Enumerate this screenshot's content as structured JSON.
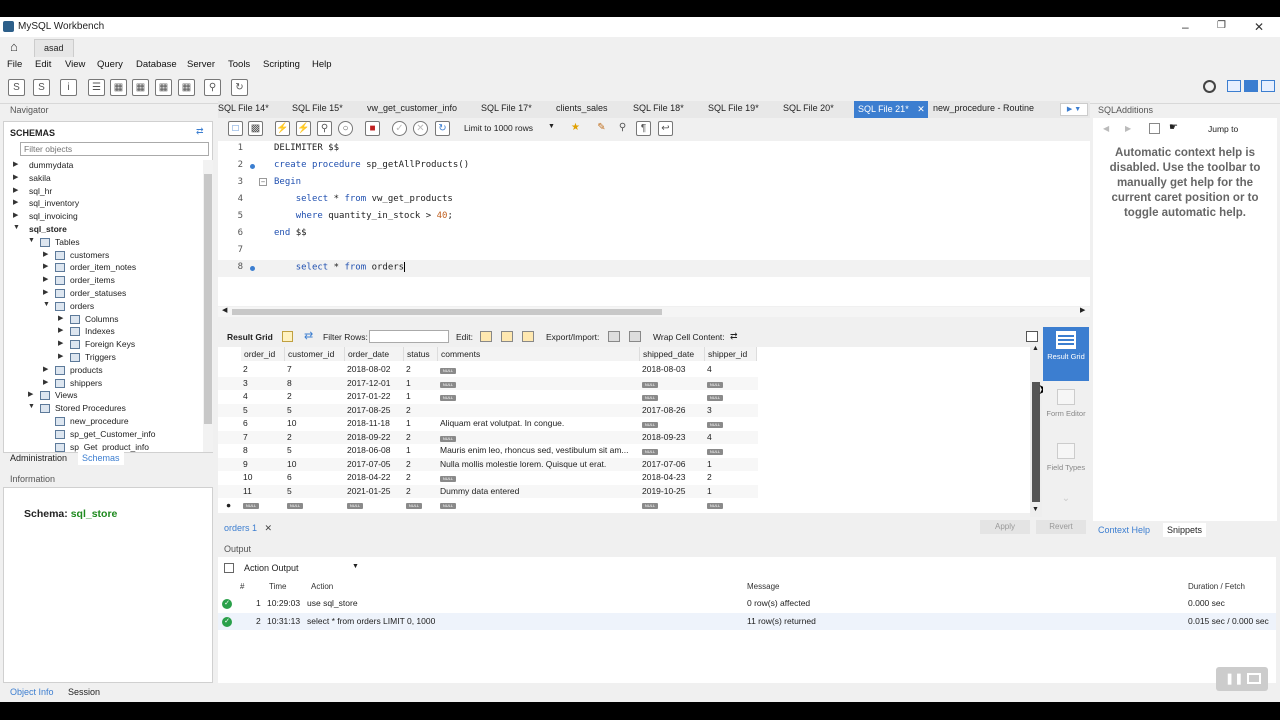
{
  "window": {
    "title": "MySQL Workbench",
    "connection_tab": "asad"
  },
  "menu": [
    "File",
    "Edit",
    "View",
    "Query",
    "Database",
    "Server",
    "Tools",
    "Scripting",
    "Help"
  ],
  "navigator": {
    "title": "Navigator",
    "schemas_label": "SCHEMAS",
    "filter_placeholder": "Filter objects",
    "tree": [
      {
        "label": "dummydata",
        "level": 0,
        "expanded": false
      },
      {
        "label": "sakila",
        "level": 0,
        "expanded": false
      },
      {
        "label": "sql_hr",
        "level": 0,
        "expanded": false
      },
      {
        "label": "sql_inventory",
        "level": 0,
        "expanded": false
      },
      {
        "label": "sql_invoicing",
        "level": 0,
        "expanded": false
      },
      {
        "label": "sql_store",
        "level": 0,
        "expanded": true,
        "bold": true
      },
      {
        "label": "Tables",
        "level": 1,
        "expanded": true
      },
      {
        "label": "customers",
        "level": 2,
        "expanded": false
      },
      {
        "label": "order_item_notes",
        "level": 2,
        "expanded": false
      },
      {
        "label": "order_items",
        "level": 2,
        "expanded": false
      },
      {
        "label": "order_statuses",
        "level": 2,
        "expanded": false
      },
      {
        "label": "orders",
        "level": 2,
        "expanded": true
      },
      {
        "label": "Columns",
        "level": 3,
        "expanded": false
      },
      {
        "label": "Indexes",
        "level": 3,
        "expanded": false
      },
      {
        "label": "Foreign Keys",
        "level": 3,
        "expanded": false
      },
      {
        "label": "Triggers",
        "level": 3,
        "expanded": false
      },
      {
        "label": "products",
        "level": 2,
        "expanded": false
      },
      {
        "label": "shippers",
        "level": 2,
        "expanded": false
      },
      {
        "label": "Views",
        "level": 1,
        "expanded": false
      },
      {
        "label": "Stored Procedures",
        "level": 1,
        "expanded": true
      },
      {
        "label": "new_procedure",
        "level": 2,
        "leaf": true
      },
      {
        "label": "sp_get_Customer_info",
        "level": 2,
        "leaf": true
      },
      {
        "label": "sp_Get_product_info",
        "level": 2,
        "leaf": true
      }
    ],
    "tabs": [
      "Administration",
      "Schemas"
    ]
  },
  "information": {
    "title": "Information",
    "schema_label": "Schema:",
    "schema_value": "sql_store"
  },
  "editor_tabs": [
    "SQL File 14*",
    "SQL File 15*",
    "vw_get_customer_info",
    "SQL File 17*",
    "clients_sales",
    "SQL File 18*",
    "SQL File 19*",
    "SQL File 20*",
    "SQL File 21*",
    "new_procedure - Routine"
  ],
  "active_tab_index": 8,
  "query_toolbar": {
    "limit": "Limit to 1000 rows"
  },
  "code": [
    {
      "n": "1",
      "text": "DELIMITER $$"
    },
    {
      "n": "2",
      "text": "create procedure sp_getAllProducts()"
    },
    {
      "n": "3",
      "text": "Begin"
    },
    {
      "n": "4",
      "text": "    select * from vw_get_products"
    },
    {
      "n": "5",
      "text": "    where quantity_in_stock > 40;"
    },
    {
      "n": "6",
      "text": "end $$"
    },
    {
      "n": "7",
      "text": ""
    },
    {
      "n": "8",
      "text": "    select * from orders"
    }
  ],
  "result_bar": {
    "result_grid": "Result Grid",
    "filter_rows": "Filter Rows:",
    "edit": "Edit:",
    "export_import": "Export/Import:",
    "wrap": "Wrap Cell Content:"
  },
  "grid": {
    "columns": [
      "order_id",
      "customer_id",
      "order_date",
      "status",
      "comments",
      "shipped_date",
      "shipper_id"
    ],
    "rows": [
      [
        "2",
        "7",
        "2018-08-02",
        "2",
        null,
        "2018-08-03",
        "4"
      ],
      [
        "3",
        "8",
        "2017-12-01",
        "1",
        null,
        null,
        null
      ],
      [
        "4",
        "2",
        "2017-01-22",
        "1",
        null,
        null,
        null
      ],
      [
        "5",
        "5",
        "2017-08-25",
        "2",
        "",
        "2017-08-26",
        "3"
      ],
      [
        "6",
        "10",
        "2018-11-18",
        "1",
        "Aliquam erat volutpat. In congue.",
        null,
        null
      ],
      [
        "7",
        "2",
        "2018-09-22",
        "2",
        null,
        "2018-09-23",
        "4"
      ],
      [
        "8",
        "5",
        "2018-06-08",
        "1",
        "Mauris enim leo, rhoncus sed, vestibulum sit am...",
        null,
        null
      ],
      [
        "9",
        "10",
        "2017-07-05",
        "2",
        "Nulla mollis molestie lorem. Quisque ut erat.",
        "2017-07-06",
        "1"
      ],
      [
        "10",
        "6",
        "2018-04-22",
        "2",
        null,
        "2018-04-23",
        "2"
      ],
      [
        "11",
        "5",
        "2021-01-25",
        "2",
        "Dummy data entered",
        "2019-10-25",
        "1"
      ],
      [
        null,
        null,
        null,
        null,
        null,
        null,
        null
      ]
    ],
    "null_text": "NULL"
  },
  "side_panel": [
    "Result Grid",
    "Form Editor",
    "Field Types"
  ],
  "result_tab": "orders 1",
  "apply": "Apply",
  "revert": "Revert",
  "output": {
    "title": "Output",
    "selector": "Action Output",
    "headers": [
      "#",
      "Time",
      "Action",
      "Message",
      "Duration / Fetch"
    ],
    "rows": [
      {
        "n": "1",
        "time": "10:29:03",
        "action": "use sql_store",
        "message": "0 row(s) affected",
        "duration": "0.000 sec"
      },
      {
        "n": "2",
        "time": "10:31:13",
        "action": "select * from orders LIMIT 0, 1000",
        "message": "11 row(s) returned",
        "duration": "0.015 sec / 0.000 sec"
      }
    ]
  },
  "sql_additions": {
    "title": "SQLAdditions",
    "jump_to": "Jump to",
    "help_text": "Automatic context help is disabled. Use the toolbar to manually get help for the current caret position or to toggle automatic help.",
    "tabs": [
      "Context Help",
      "Snippets"
    ]
  },
  "bottom_tabs": [
    "Object Info",
    "Session"
  ],
  "colors": {
    "accent": "#3c7ed0",
    "keyword": "#2050b0",
    "ok": "#2aa04a",
    "schema": "#1e8a1e"
  }
}
